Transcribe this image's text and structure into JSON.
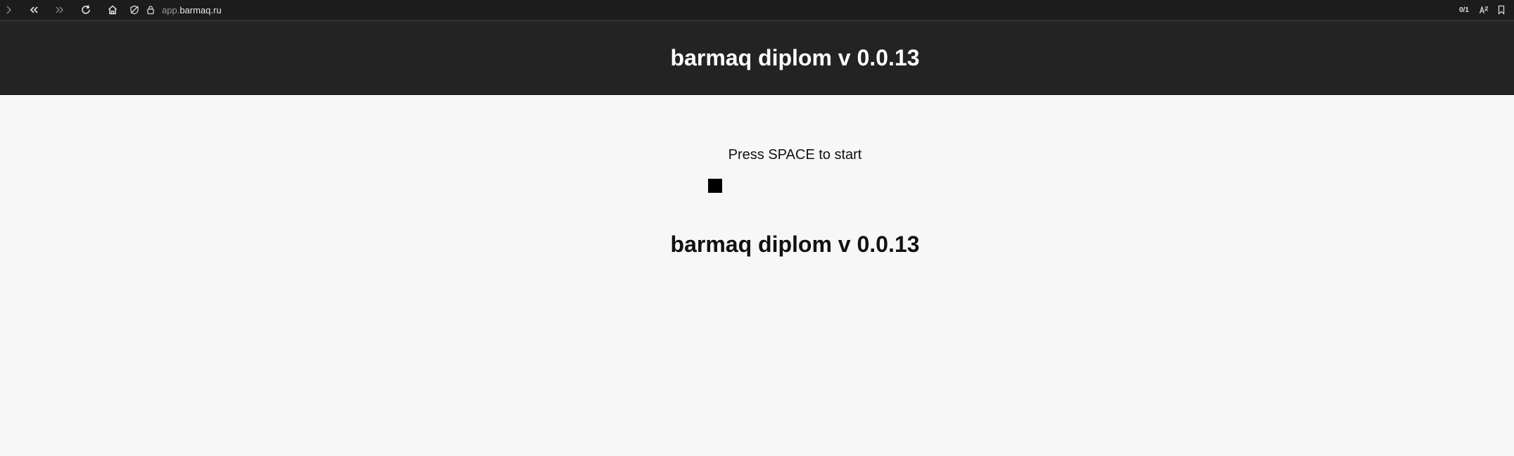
{
  "browser": {
    "url_prefix": "app.",
    "url_host": "barmaq.ru",
    "find_counter": "0/1",
    "icons": [
      "chevron-right-icon",
      "back-double-icon",
      "forward-double-icon",
      "reload-icon",
      "home-icon",
      "shield-off-icon",
      "lock-icon",
      "translate-icon",
      "bookmark-icon"
    ]
  },
  "header": {
    "title": "barmaq diplom v 0.0.13"
  },
  "main": {
    "prompt": "Press SPACE to start",
    "title": "barmaq diplom v 0.0.13"
  },
  "colors": {
    "browser_bar": "#1c1c1c",
    "header_bg": "#232323",
    "page_bg": "#f7f7f7",
    "player": "#000000"
  }
}
